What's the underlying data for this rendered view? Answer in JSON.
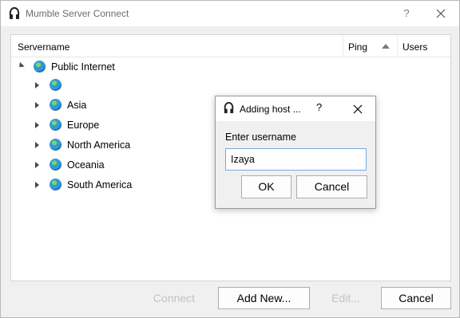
{
  "window": {
    "title": "Mumble Server Connect",
    "help": "?"
  },
  "tree": {
    "columns": {
      "name": "Servername",
      "ping": "Ping",
      "users": "Users"
    },
    "root": "Public Internet",
    "children": [
      "",
      "Asia",
      "Europe",
      "North America",
      "Oceania",
      "South America"
    ]
  },
  "buttons": {
    "connect": "Connect",
    "add_new": "Add New...",
    "edit": "Edit...",
    "cancel": "Cancel"
  },
  "dialog": {
    "title": "Adding host ...",
    "help": "?",
    "prompt": "Enter username",
    "input_value": "Izaya",
    "ok": "OK",
    "cancel": "Cancel"
  },
  "colors": {
    "input_focus_border": "#7aa7dd",
    "disabled_text": "#c3c3c3"
  },
  "icons": {
    "app": "mumble-headphones-icon",
    "close": "close-icon",
    "globe": "globe-icon",
    "expand": "chevron-right-icon",
    "collapse": "chevron-down-icon",
    "sort": "sort-ascending-icon"
  }
}
